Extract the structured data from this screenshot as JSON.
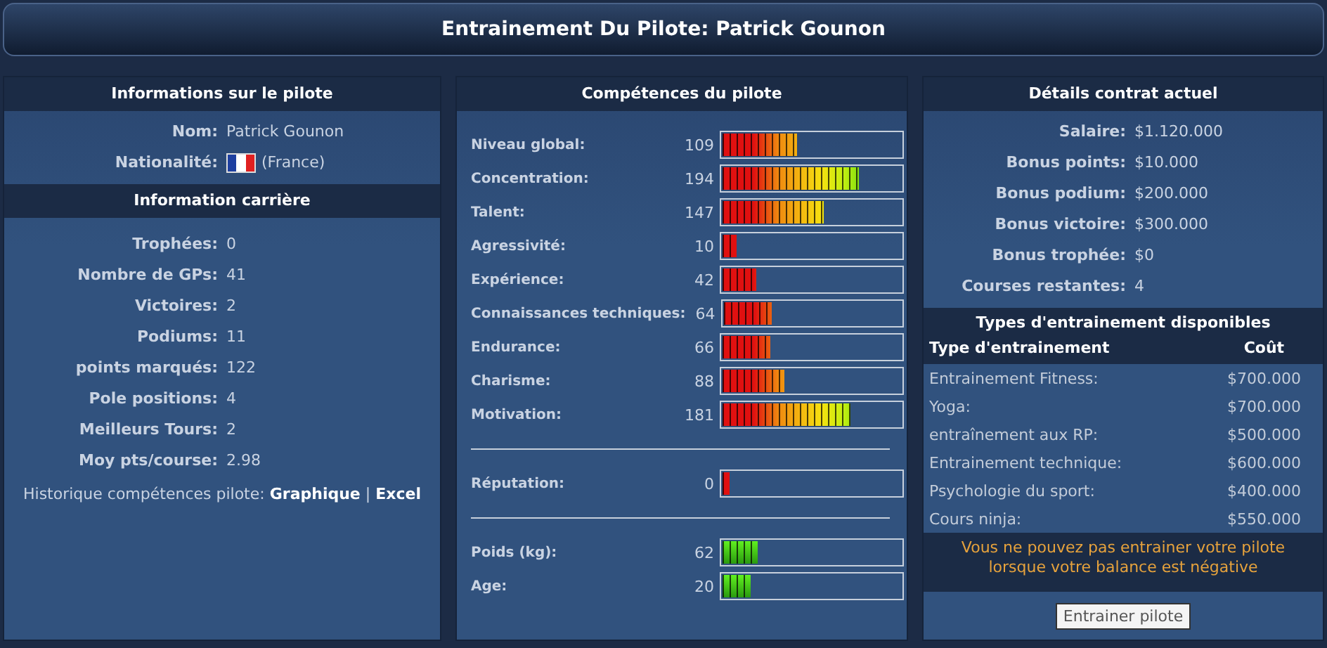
{
  "title": "Entrainement Du Pilote: Patrick Gounon",
  "driver_info": {
    "heading": "Informations sur le pilote",
    "name_label": "Nom:",
    "name": "Patrick Gounon",
    "nationality_label": "Nationalité:",
    "nationality": "(France)"
  },
  "career": {
    "heading": "Information carrière",
    "rows": [
      {
        "label": "Trophées:",
        "value": "0"
      },
      {
        "label": "Nombre de GPs:",
        "value": "41"
      },
      {
        "label": "Victoires:",
        "value": "2"
      },
      {
        "label": "Podiums:",
        "value": "11"
      },
      {
        "label": "points marqués:",
        "value": "122"
      },
      {
        "label": "Pole positions:",
        "value": "4"
      },
      {
        "label": "Meilleurs Tours:",
        "value": "2"
      },
      {
        "label": "Moy pts/course:",
        "value": "2.98"
      }
    ],
    "history_label": "Historique compétences pilote:",
    "links": [
      "Graphique",
      "Excel"
    ],
    "separator": "|"
  },
  "skills": {
    "heading": "Compétences du pilote",
    "groups": [
      [
        {
          "label": "Niveau global:",
          "value": "109",
          "level": 0.42,
          "kind": "scale"
        },
        {
          "label": "Concentration:",
          "value": "194",
          "level": 0.76,
          "kind": "scale"
        },
        {
          "label": "Talent:",
          "value": "147",
          "level": 0.57,
          "kind": "scale"
        },
        {
          "label": "Agressivité:",
          "value": "10",
          "level": 0.08,
          "kind": "scale"
        },
        {
          "label": "Expérience:",
          "value": "42",
          "level": 0.19,
          "kind": "scale"
        },
        {
          "label": "Connaissances techniques:",
          "value": "64",
          "level": 0.27,
          "kind": "scale"
        },
        {
          "label": "Endurance:",
          "value": "66",
          "level": 0.27,
          "kind": "scale"
        },
        {
          "label": "Charisme:",
          "value": "88",
          "level": 0.35,
          "kind": "scale"
        },
        {
          "label": "Motivation:",
          "value": "181",
          "level": 0.72,
          "kind": "scale"
        }
      ],
      [
        {
          "label": "Réputation:",
          "value": "0",
          "level": 0.04,
          "kind": "scale"
        }
      ],
      [
        {
          "label": "Poids (kg):",
          "value": "62",
          "level": 0.2,
          "kind": "green"
        },
        {
          "label": "Age:",
          "value": "20",
          "level": 0.16,
          "kind": "green"
        }
      ]
    ]
  },
  "contract": {
    "heading": "Détails contrat actuel",
    "rows": [
      {
        "label": "Salaire:",
        "value": "$1.120.000"
      },
      {
        "label": "Bonus points:",
        "value": "$10.000"
      },
      {
        "label": "Bonus podium:",
        "value": "$200.000"
      },
      {
        "label": "Bonus victoire:",
        "value": "$300.000"
      },
      {
        "label": "Bonus trophée:",
        "value": "$0"
      },
      {
        "label": "Courses restantes:",
        "value": "4"
      }
    ]
  },
  "training": {
    "heading": "Types d'entrainement disponibles",
    "columns": [
      "Type d'entrainement",
      "Coût"
    ],
    "rows": [
      {
        "type": "Entrainement Fitness:",
        "cost": "$700.000"
      },
      {
        "type": "Yoga:",
        "cost": "$700.000"
      },
      {
        "type": "entraînement aux RP:",
        "cost": "$500.000"
      },
      {
        "type": "Entrainement technique:",
        "cost": "$600.000"
      },
      {
        "type": "Psychologie du sport:",
        "cost": "$400.000"
      },
      {
        "type": "Cours ninja:",
        "cost": "$550.000"
      }
    ],
    "warning": "Vous ne pouvez pas entrainer votre pilote lorsque votre balance est négative",
    "button": "Entrainer pilote"
  }
}
